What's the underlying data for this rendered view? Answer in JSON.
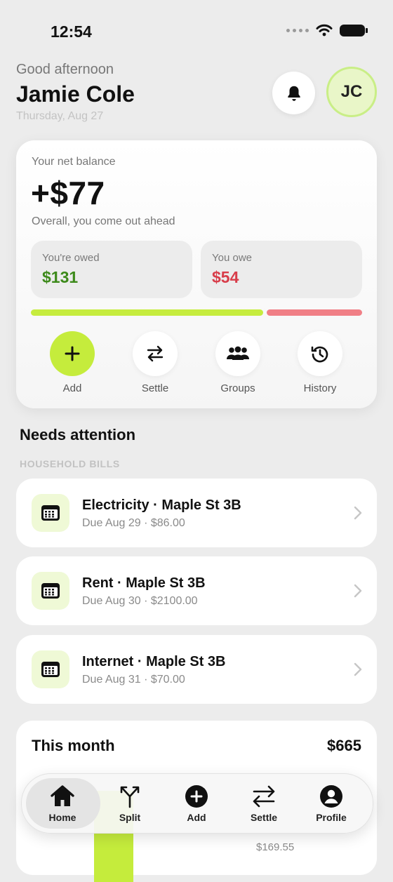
{
  "status": {
    "time": "12:54"
  },
  "header": {
    "greeting": "Good afternoon",
    "name": "Jamie Cole",
    "date": "Thursday, Aug 27",
    "avatar_initials": "JC",
    "bell_icon": "bell-icon"
  },
  "balance": {
    "label": "Your net balance",
    "amount": "+$77",
    "subtitle": "Overall, you come out ahead",
    "owed_label": "You're owed",
    "owed_value": "$131",
    "owe_label": "You owe",
    "owe_value": "$54",
    "owed_share": 0.708,
    "owe_share": 0.292,
    "colors": {
      "owed": "#c6ec3e",
      "owe": "#f07f86",
      "accent": "#c5ec3c"
    }
  },
  "actions": [
    {
      "label": "Add",
      "icon": "plus-icon"
    },
    {
      "label": "Settle",
      "icon": "swap-arrows-icon"
    },
    {
      "label": "Groups",
      "icon": "people-icon"
    },
    {
      "label": "History",
      "icon": "history-icon"
    }
  ],
  "attention": {
    "title": "Needs attention",
    "group_label": "HOUSEHOLD BILLS",
    "bills": [
      {
        "title": "Electricity · Maple St 3B",
        "detail": "Due Aug 29 · $86.00",
        "icon": "calendar-icon"
      },
      {
        "title": "Rent · Maple St 3B",
        "detail": "Due Aug 30 · $2100.00",
        "icon": "calendar-icon"
      },
      {
        "title": "Internet · Maple St 3B",
        "detail": "Due Aug 31 · $70.00",
        "icon": "calendar-icon"
      }
    ]
  },
  "month": {
    "title": "This month",
    "total": "$665",
    "value_label": "$169.55"
  },
  "tabbar": {
    "active": "Home",
    "tabs": [
      {
        "label": "Home",
        "icon": "home-icon"
      },
      {
        "label": "Split",
        "icon": "split-icon"
      },
      {
        "label": "Add",
        "icon": "plus-circle-icon"
      },
      {
        "label": "Settle",
        "icon": "swap-arrows-icon"
      },
      {
        "label": "Profile",
        "icon": "person-icon"
      }
    ]
  }
}
